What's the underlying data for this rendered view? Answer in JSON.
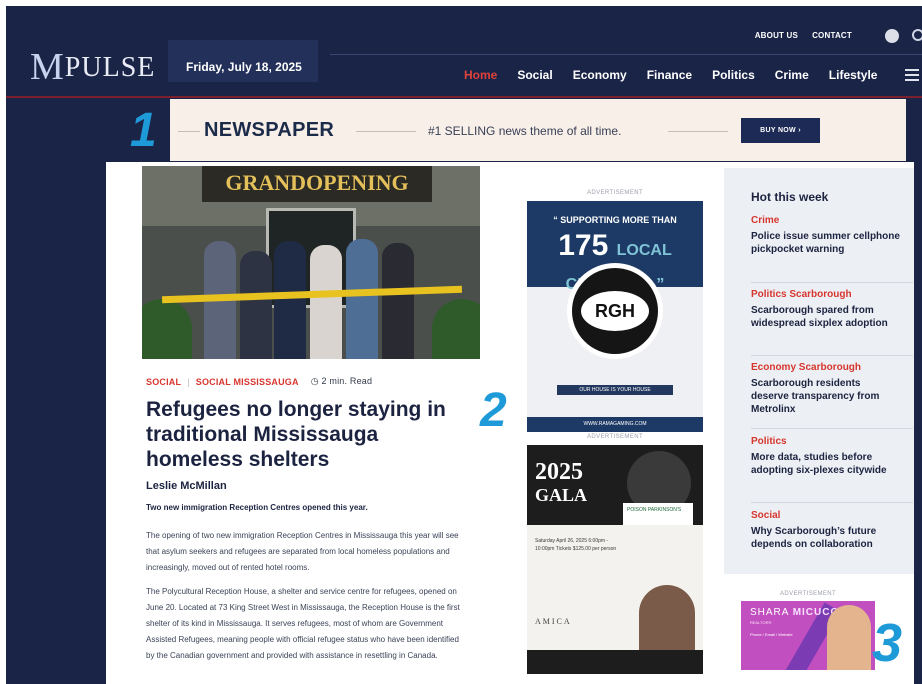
{
  "header": {
    "logo_mark": "M",
    "logo_text": "PULSE",
    "date": "Friday, July 18, 2025",
    "top_links": [
      "ABOUT US",
      "CONTACT"
    ],
    "nav": [
      "Home",
      "Social",
      "Economy",
      "Finance",
      "Politics",
      "Crime",
      "Lifestyle"
    ]
  },
  "banner": {
    "title": "NEWSPAPER",
    "tagline": "#1 SELLING news theme of all time.",
    "cta": "BUY NOW ›"
  },
  "markers": [
    "1",
    "2",
    "3"
  ],
  "article": {
    "image_sign": "GRANDOPENING",
    "categories": [
      "SOCIAL",
      "SOCIAL MISSISSAUGA"
    ],
    "read_time": "2 min. Read",
    "title": "Refugees no longer staying in traditional Mississauga homeless shelters",
    "author": "Leslie McMillan",
    "lede": "Two new immigration Reception Centres opened this year.",
    "paragraphs": [
      "The opening of two new immigration Reception Centres in Mississauga this year will see that asylum seekers and refugees are separated from local homeless populations and increasingly, moved out of rented hotel rooms.",
      "The Polycultural Reception House, a shelter and service centre for refugees, opened on June 20. Located at 73 King Street West in Mississauga, the Reception House is the first shelter of its kind in Mississauga. It serves refugees, most of whom are Government Assisted Refugees, meaning people with official refugee status who have been identified by the Canadian government and provided with assistance in resettling in Canada."
    ]
  },
  "ads": {
    "label": "ADVERTISEMENT",
    "ad1": {
      "line1": "“ SUPPORTING MORE THAN",
      "big": "175",
      "small": "LOCAL CHARITIES ”",
      "badge": "RGH",
      "footer": "OUR HOUSE IS YOUR HOUSE",
      "bar": "WWW.RAMAGAMING.COM"
    },
    "ad2": {
      "year": "2025",
      "title": "GALA",
      "logo": "POISON PARKINSON'S",
      "amica": "AMICA",
      "text": "Saturday April 26, 2025 6:00pm - 10:00pm Tickets $125.00 per person"
    },
    "ad3": {
      "name_first": "SHARA",
      "name_last": "MICUCCI",
      "subtitle": "REALTOR®",
      "lines": "Phone / Email / Website"
    }
  },
  "sidebar": {
    "title": "Hot this week",
    "items": [
      {
        "category": "Crime",
        "headline": "Police issue summer cellphone pickpocket warning"
      },
      {
        "category": "Politics Scarborough",
        "headline": "Scarborough spared from widespread sixplex adoption"
      },
      {
        "category": "Economy Scarborough",
        "headline": "Scarborough residents deserve transparency from Metrolinx"
      },
      {
        "category": "Politics",
        "headline": "More data, studies before adopting six-plexes citywide"
      },
      {
        "category": "Social",
        "headline": "Why Scarborough’s future depends on collaboration"
      }
    ]
  },
  "colors": {
    "navy": "#1a2447",
    "accent_red": "#d7362e",
    "marker_blue": "#1f9ad8"
  }
}
